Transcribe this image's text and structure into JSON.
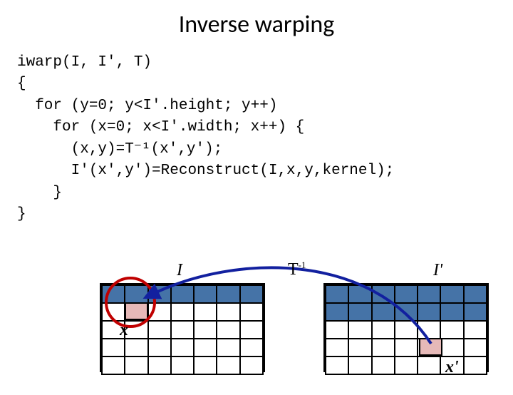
{
  "title": "Inverse warping",
  "code": {
    "l1": "iwarp(I, I', T)",
    "l2": "{",
    "l3": "  for (y=0; y<I'.height; y++)",
    "l4": "    for (x=0; x<I'.width; x++) {",
    "l5": "      (x,y)=T⁻¹(x',y');",
    "l6": "      I'(x',y')=Reconstruct(I,x,y,kernel);",
    "l7": "    }",
    "l8": "}"
  },
  "labels": {
    "I": "I",
    "Tinv": "T",
    "Tinv_sup": "-1",
    "Iprime": "I'",
    "x": "x",
    "xprime": "x'"
  }
}
